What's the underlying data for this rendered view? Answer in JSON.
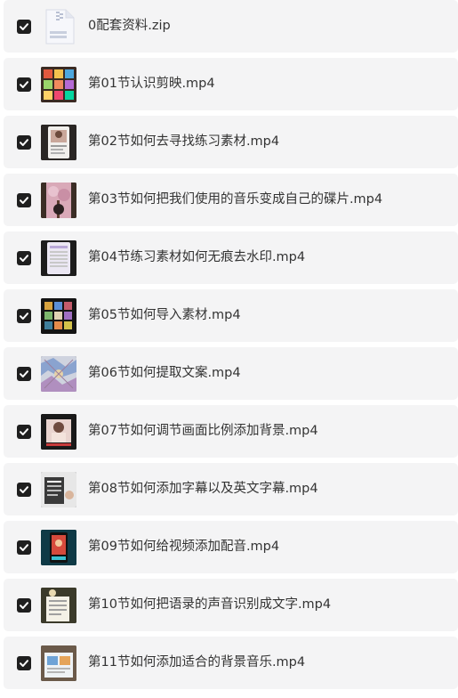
{
  "files": [
    {
      "name": "0配套资料.zip",
      "checked": true,
      "type": "zip",
      "icon": "zip-file-icon"
    },
    {
      "name": "第01节认识剪映.mp4",
      "checked": true,
      "type": "video",
      "icon": "video-thumbnail"
    },
    {
      "name": "第02节如何去寻找练习素材.mp4",
      "checked": true,
      "type": "video",
      "icon": "video-thumbnail"
    },
    {
      "name": "第03节如何把我们使用的音乐变成自己的碟片.mp4",
      "checked": true,
      "type": "video",
      "icon": "video-thumbnail"
    },
    {
      "name": "第04节练习素材如何无痕去水印.mp4",
      "checked": true,
      "type": "video",
      "icon": "video-thumbnail"
    },
    {
      "name": "第05节如何导入素材.mp4",
      "checked": true,
      "type": "video",
      "icon": "video-thumbnail"
    },
    {
      "name": "第06节如何提取文案.mp4",
      "checked": true,
      "type": "video",
      "icon": "video-thumbnail"
    },
    {
      "name": "第07节如何调节画面比例添加背景.mp4",
      "checked": true,
      "type": "video",
      "icon": "video-thumbnail"
    },
    {
      "name": "第08节如何添加字幕以及英文字幕.mp4",
      "checked": true,
      "type": "video",
      "icon": "video-thumbnail"
    },
    {
      "name": "第09节如何给视频添加配音.mp4",
      "checked": true,
      "type": "video",
      "icon": "video-thumbnail"
    },
    {
      "name": "第10节如何把语录的声音识别成文字.mp4",
      "checked": true,
      "type": "video",
      "icon": "video-thumbnail"
    },
    {
      "name": "第11节如何添加适合的背景音乐.mp4",
      "checked": true,
      "type": "video",
      "icon": "video-thumbnail"
    }
  ],
  "colors": {
    "row_background": "#f4f4f5",
    "checkbox": "#1f1f1f",
    "text": "#333333"
  }
}
